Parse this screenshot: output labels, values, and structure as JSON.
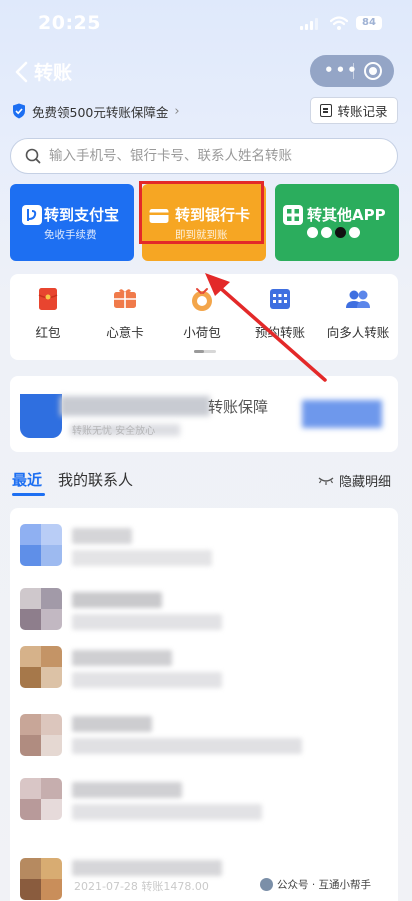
{
  "status_bar": {
    "time": "20:25",
    "battery": "84"
  },
  "nav": {
    "title": "转账",
    "menu_dots": "•••"
  },
  "guarantee": {
    "text": "免费领500元转账保障金",
    "arrow": "›"
  },
  "records_button": {
    "label": "转账记录"
  },
  "search": {
    "placeholder": "输入手机号、银行卡号、联系人姓名转账"
  },
  "cards": {
    "alipay": {
      "title": "转到支付宝",
      "subtitle": "免收手续费"
    },
    "bank": {
      "title": "转到银行卡",
      "subtitle": "即到就到账"
    },
    "other": {
      "title": "转其他APP"
    }
  },
  "quick_actions": [
    {
      "label": "红包",
      "icon": "red-packet-icon"
    },
    {
      "label": "心意卡",
      "icon": "gift-card-icon"
    },
    {
      "label": "小荷包",
      "icon": "purse-icon"
    },
    {
      "label": "预约转账",
      "icon": "calendar-icon"
    },
    {
      "label": "向多人转账",
      "icon": "people-icon"
    }
  ],
  "banner": {
    "partial_text": "转账保障",
    "sub_text": "转账无忧 安全放心"
  },
  "tabs": {
    "recent": "最近",
    "contacts": "我的联系人",
    "hide": "隐藏明细"
  },
  "list": {
    "last_date": "2021-07-28 转账1478.00"
  },
  "watermark": {
    "text": "公众号 · 互通小帮手"
  },
  "colors": {
    "primary": "#1d6ff2",
    "bank_card": "#f6a623",
    "other_app": "#2bad5d",
    "highlight": "#e32929"
  }
}
